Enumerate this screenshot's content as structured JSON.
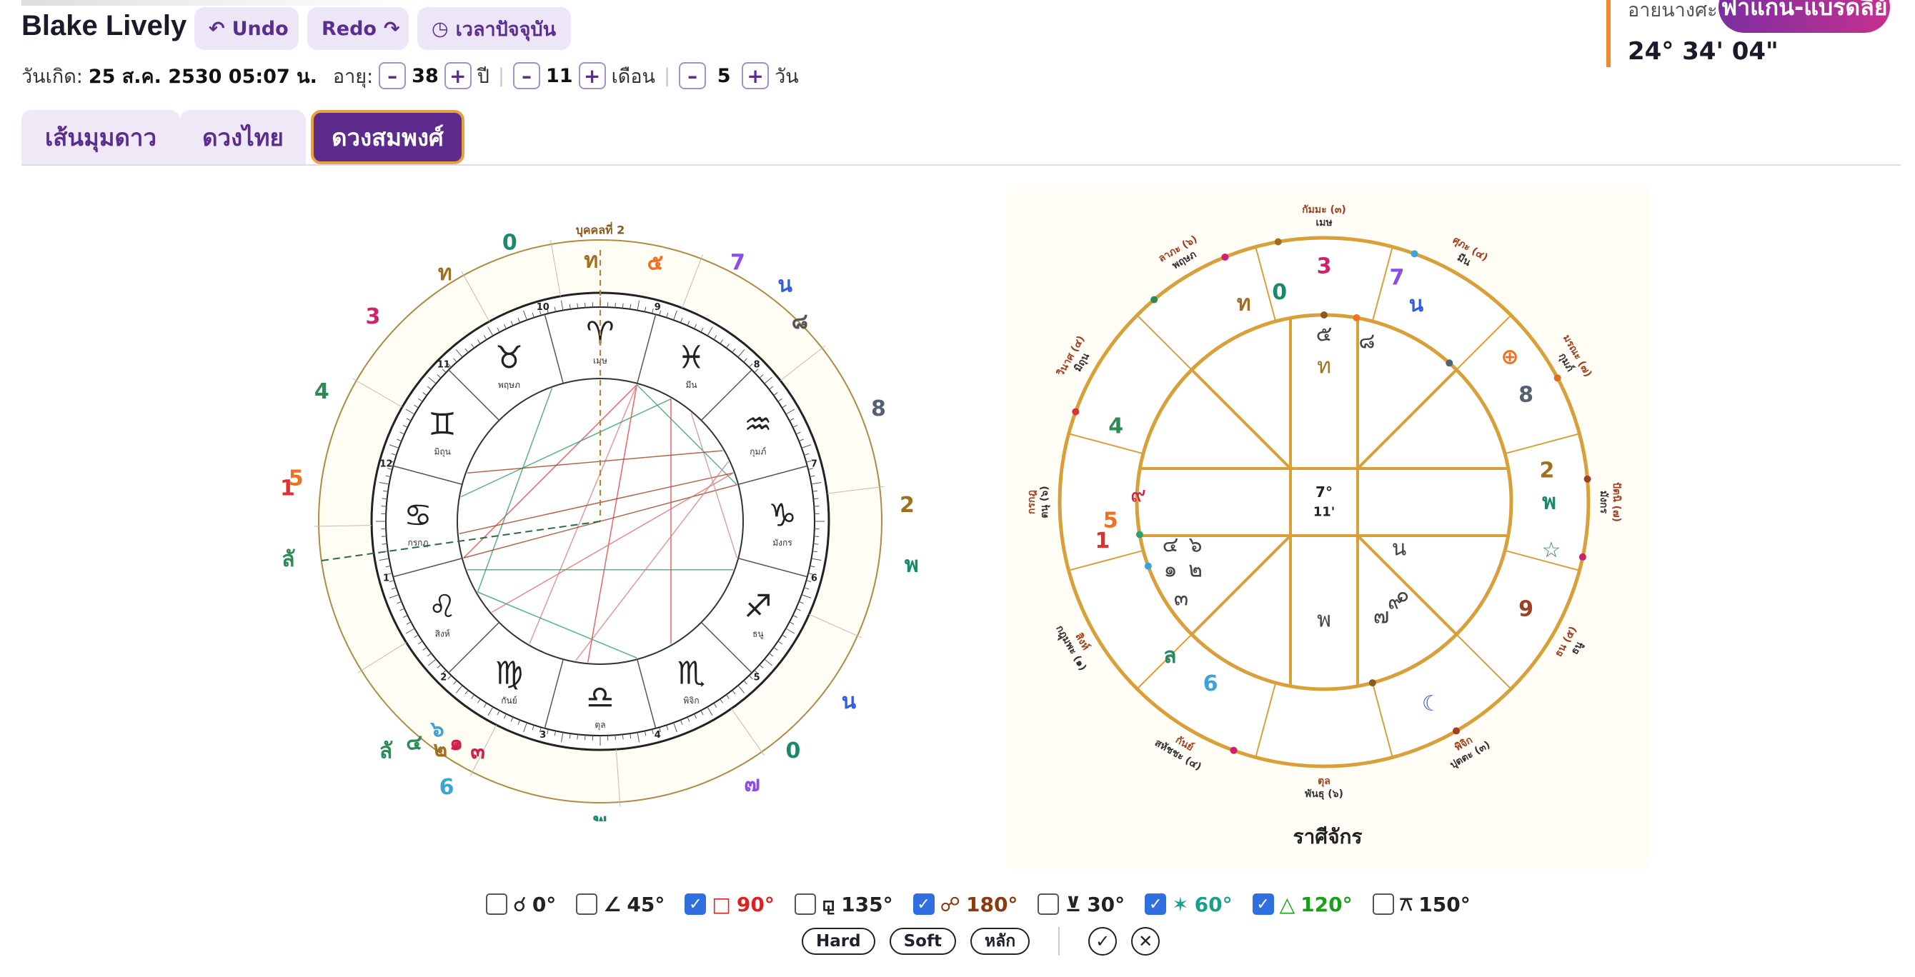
{
  "header": {
    "name": "Blake Lively",
    "undo_label": "Undo",
    "redo_label": "Redo",
    "now_label": "เวลาปัจจุบัน"
  },
  "birth": {
    "label": "วันเกิด:",
    "value": "25 ส.ค. 2530 05:07 น.",
    "age_label": "อายุ:",
    "years": "38",
    "years_unit": "ปี",
    "months": "11",
    "months_unit": "เดือน",
    "days": "5",
    "days_unit": "วัน",
    "minus": "–",
    "plus": "+"
  },
  "location": {
    "label": "อายนางศะ",
    "badge": "ฟาแกน-แบรดลีย์",
    "coord": "24° 34' 04\""
  },
  "tabs": [
    {
      "label": "เส้นมุมดาว",
      "active": false
    },
    {
      "label": "ดวงไทย",
      "active": false
    },
    {
      "label": "ดวงสมพงศ์",
      "active": true
    }
  ],
  "wheel": {
    "person2_label": "บุคคลที่ 2",
    "signs": [
      {
        "glyph": "♈",
        "name": "เมษ"
      },
      {
        "glyph": "♉",
        "name": "พฤษภ"
      },
      {
        "glyph": "♊",
        "name": "มิถุน"
      },
      {
        "glyph": "♋",
        "name": "กรกฎ"
      },
      {
        "glyph": "♌",
        "name": "สิงห์"
      },
      {
        "glyph": "♍",
        "name": "กันย์"
      },
      {
        "glyph": "♎",
        "name": "ตุล"
      },
      {
        "glyph": "♏",
        "name": "พิจิก"
      },
      {
        "glyph": "♐",
        "name": "ธนู"
      },
      {
        "glyph": "♑",
        "name": "มังกร"
      },
      {
        "glyph": "♒",
        "name": "กุมภ์"
      },
      {
        "glyph": "♓",
        "name": "มีน"
      }
    ],
    "house_numbers": [
      "1",
      "2",
      "3",
      "4",
      "5",
      "6",
      "7",
      "8",
      "9",
      "10",
      "11",
      "12"
    ],
    "outer_labels": [
      {
        "text": "ท",
        "color": "#a07020"
      },
      {
        "text": "๕",
        "color": "#f07020"
      },
      {
        "text": "7",
        "color": "#8a4ee8"
      },
      {
        "text": "น",
        "color": "#2f5fe0"
      },
      {
        "text": "๘",
        "color": "#555"
      },
      {
        "text": "8",
        "color": "#556070"
      },
      {
        "text": "2",
        "color": "#a07020"
      },
      {
        "text": "พ",
        "color": "#1a8a6a"
      },
      {
        "text": "น",
        "color": "#2f5fe0"
      },
      {
        "text": "0",
        "color": "#1a8a6a"
      },
      {
        "text": "๗",
        "color": "#8a4ee8"
      },
      {
        "text": "พ",
        "color": "#1a8a6a"
      },
      {
        "text": "6",
        "color": "#3ba3d8"
      },
      {
        "text": "๒",
        "color": "#a07020"
      },
      {
        "text": "๔",
        "color": "#2e8b57"
      },
      {
        "text": "ลั",
        "color": "#2e8b57"
      },
      {
        "text": "๖",
        "color": "#3ba3d8"
      },
      {
        "text": "๑",
        "color": "#d0204a"
      },
      {
        "text": "๓",
        "color": "#d0204a"
      },
      {
        "text": "ลั",
        "color": "#2e8b57"
      },
      {
        "text": "1",
        "color": "#e03030"
      },
      {
        "text": "5",
        "color": "#f07020"
      },
      {
        "text": "4",
        "color": "#2e8b57"
      },
      {
        "text": "3",
        "color": "#d0206a"
      },
      {
        "text": "ท",
        "color": "#a07020"
      },
      {
        "text": "0",
        "color": "#1a8a6a"
      }
    ]
  },
  "rasi": {
    "title": "ราศีจักร",
    "center_line1": "7°",
    "center_line2": "11'",
    "signs": [
      {
        "text": "กัมมะ (๓)",
        "sub": "เมษ"
      },
      {
        "text": "ศุภะ (๔)",
        "sub": "มีน"
      },
      {
        "text": "มรณะ (๗)",
        "sub": "กุมภ์"
      },
      {
        "text": "ปัตนิ (๗)",
        "sub": "มังกร"
      },
      {
        "text": "ธน (๕)",
        "sub": "ธนู"
      },
      {
        "text": "พิจิก",
        "sub": "ปุตตะ (๓)"
      },
      {
        "text": "ตุล",
        "sub": "พันธุ (๖)"
      },
      {
        "text": "กันย์",
        "sub": "สหัชชะ (๔)"
      },
      {
        "text": "สิงห์",
        "sub": "กฎุมพะ (๑)"
      },
      {
        "text": "กรกฎ",
        "sub": "ตนุ (๖)"
      },
      {
        "text": "วินาศ (๔)",
        "sub": "มิถุน"
      },
      {
        "text": "ลาภะ (๖)",
        "sub": "พฤษภ"
      }
    ],
    "outer_labels": [
      {
        "text": "ท",
        "color": "#a07020"
      },
      {
        "text": "0",
        "color": "#1a8a6a"
      },
      {
        "text": "3",
        "color": "#d0206a"
      },
      {
        "text": "7",
        "color": "#8a4ee8"
      },
      {
        "text": "น",
        "color": "#2f5fe0"
      },
      {
        "text": "⊕",
        "color": "#f07020"
      },
      {
        "text": "8",
        "color": "#556070"
      },
      {
        "text": "2",
        "color": "#a07020"
      },
      {
        "text": "พ",
        "color": "#1a8a6a"
      },
      {
        "text": "☆",
        "color": "#2e8b57"
      },
      {
        "text": "9",
        "color": "#a04020"
      },
      {
        "text": "☾",
        "color": "#2f5fe0"
      },
      {
        "text": "6",
        "color": "#3ba3d8"
      },
      {
        "text": "ล",
        "color": "#1a8a6a"
      },
      {
        "text": "1",
        "color": "#e03030"
      },
      {
        "text": "5",
        "color": "#f07020"
      },
      {
        "text": "4",
        "color": "#2e8b57"
      }
    ],
    "inner_labels": [
      {
        "text": "๕",
        "color": "#444"
      },
      {
        "text": "ท",
        "color": "#a07020"
      },
      {
        "text": "๘",
        "color": "#444"
      },
      {
        "text": "๙",
        "color": "#d0204a"
      },
      {
        "text": "๔",
        "color": "#444"
      },
      {
        "text": "๖",
        "color": "#444"
      },
      {
        "text": "๑",
        "color": "#444"
      },
      {
        "text": "๒",
        "color": "#444"
      },
      {
        "text": "๓",
        "color": "#444"
      },
      {
        "text": "พ",
        "color": "#444"
      },
      {
        "text": "น",
        "color": "#444"
      },
      {
        "text": "๙",
        "color": "#444"
      },
      {
        "text": "๗",
        "color": "#444"
      },
      {
        "text": "๐",
        "color": "#444"
      }
    ]
  },
  "aspects": [
    {
      "symbol": "☌",
      "label": "0°",
      "checked": false,
      "color": "#222"
    },
    {
      "symbol": "∠",
      "label": "45°",
      "checked": false,
      "color": "#222"
    },
    {
      "symbol": "□",
      "label": "90°",
      "checked": true,
      "color": "#e02020"
    },
    {
      "symbol": "⚼",
      "label": "135°",
      "checked": false,
      "color": "#222"
    },
    {
      "symbol": "☍",
      "label": "180°",
      "checked": true,
      "color": "#8a3a10"
    },
    {
      "symbol": "⊻",
      "label": "30°",
      "checked": false,
      "color": "#222"
    },
    {
      "symbol": "✶",
      "label": "60°",
      "checked": true,
      "color": "#18a088"
    },
    {
      "symbol": "△",
      "label": "120°",
      "checked": true,
      "color": "#18a018"
    },
    {
      "symbol": "⚻",
      "label": "150°",
      "checked": false,
      "color": "#222"
    }
  ],
  "filters": {
    "hard": "Hard",
    "soft": "Soft",
    "main": "หลัก",
    "check": "✓",
    "clear": "✕"
  },
  "colors": {
    "accent": "#5d2b8b",
    "gold": "#d9a03a",
    "tab_border": "#e8a23c"
  }
}
